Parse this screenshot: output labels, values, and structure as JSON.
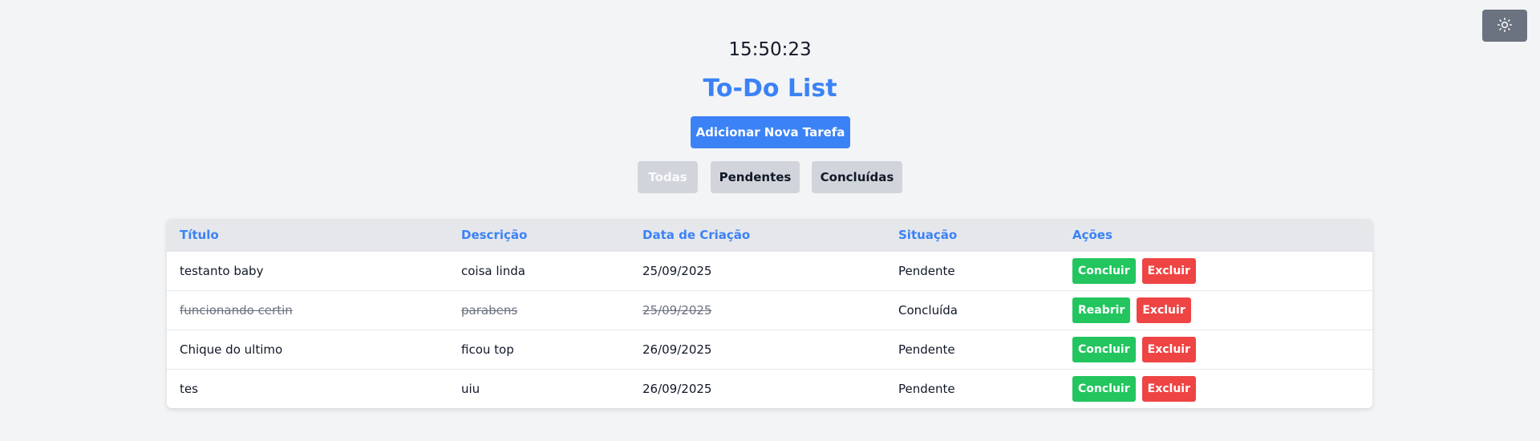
{
  "clock": "15:50:23",
  "title": "To-Do List",
  "add_button": "Adicionar Nova Tarefa",
  "theme_toggle_icon": "sun-icon",
  "filters": [
    {
      "label": "Todas",
      "active": true
    },
    {
      "label": "Pendentes",
      "active": false
    },
    {
      "label": "Concluídas",
      "active": false
    }
  ],
  "table": {
    "headers": [
      "Título",
      "Descrição",
      "Data de Criação",
      "Situação",
      "Ações"
    ],
    "rows": [
      {
        "title": "testanto baby",
        "description": "coisa linda",
        "date": "25/09/2025",
        "status": "Pendente",
        "primary_action": "Concluir",
        "delete_action": "Excluir",
        "completed": false
      },
      {
        "title": "funcionando certin",
        "description": "parabens",
        "date": "25/09/2025",
        "status": "Concluída",
        "primary_action": "Reabrir",
        "delete_action": "Excluir",
        "completed": true
      },
      {
        "title": "Chique do ultimo",
        "description": "ficou top",
        "date": "26/09/2025",
        "status": "Pendente",
        "primary_action": "Concluir",
        "delete_action": "Excluir",
        "completed": false
      },
      {
        "title": "tes",
        "description": "uiu",
        "date": "26/09/2025",
        "status": "Pendente",
        "primary_action": "Concluir",
        "delete_action": "Excluir",
        "completed": false
      }
    ]
  },
  "colors": {
    "accent": "#3b82f6",
    "success": "#22c55e",
    "danger": "#ef4444",
    "background": "#f3f4f6"
  }
}
